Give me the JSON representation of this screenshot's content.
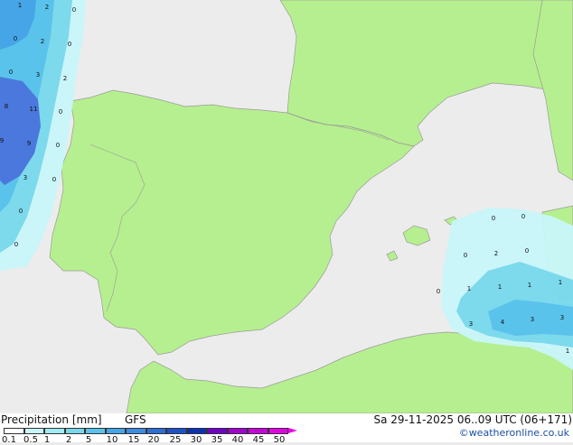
{
  "footer": {
    "title": "Precipitation [mm]",
    "model": "GFS",
    "datetime": "Sa 29-11-2025 06..09 UTC (06+171)",
    "credit": "©weatheronline.co.uk"
  },
  "legend": {
    "ticks": [
      "0.1",
      "0.5",
      "1",
      "2",
      "5",
      "10",
      "15",
      "20",
      "25",
      "30",
      "35",
      "40",
      "45",
      "50"
    ],
    "colors": [
      "#ffffff",
      "#c8f5fa",
      "#a0ebf5",
      "#78d7eb",
      "#5ac3eb",
      "#46a5e6",
      "#3c8ce1",
      "#2d6ed7",
      "#1e50c8",
      "#0a32b4",
      "#6e00c8",
      "#a000d2",
      "#c800dc",
      "#e600e6"
    ]
  },
  "colors": {
    "land": "#b6ef8f",
    "sea": "#ececec",
    "precip_light": "#c8f5fa",
    "precip_mid": "#78d7eb",
    "precip_heavy": "#4b78dc"
  },
  "map_labels": [
    {
      "text": "1"
    },
    {
      "text": "2"
    },
    {
      "text": "0"
    },
    {
      "text": "0"
    },
    {
      "text": "2"
    },
    {
      "text": "0"
    },
    {
      "text": "0"
    },
    {
      "text": "3"
    },
    {
      "text": "2"
    },
    {
      "text": "8"
    },
    {
      "text": "11"
    },
    {
      "text": "0"
    },
    {
      "text": "9"
    },
    {
      "text": "9"
    },
    {
      "text": "0"
    },
    {
      "text": "3"
    },
    {
      "text": "0"
    },
    {
      "text": "0"
    },
    {
      "text": "0"
    },
    {
      "text": "0"
    },
    {
      "text": "0"
    },
    {
      "text": "2"
    },
    {
      "text": "0"
    },
    {
      "text": "0"
    },
    {
      "text": "0"
    },
    {
      "text": "1"
    },
    {
      "text": "1"
    },
    {
      "text": "1"
    },
    {
      "text": "3"
    },
    {
      "text": "4"
    },
    {
      "text": "3"
    },
    {
      "text": "3"
    },
    {
      "text": "1"
    },
    {
      "text": "1"
    }
  ]
}
